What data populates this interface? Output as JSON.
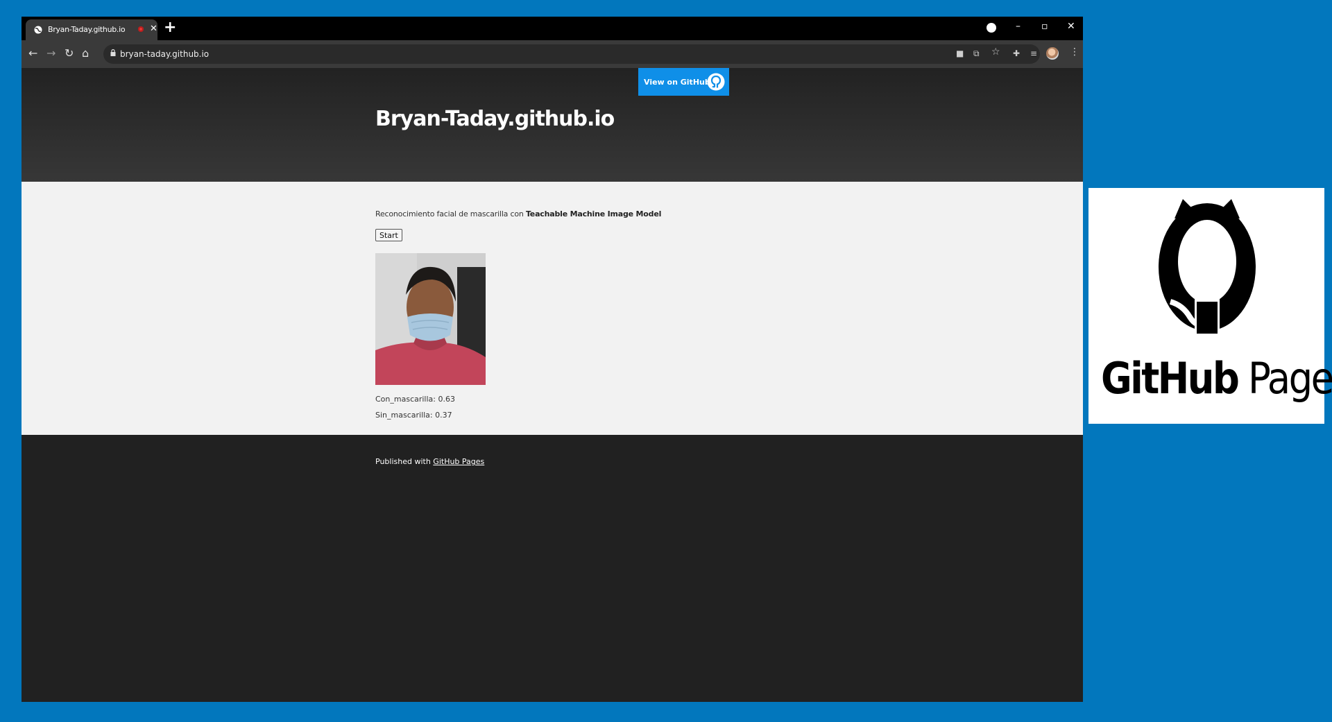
{
  "browser": {
    "tab_title": "Bryan-Taday.github.io",
    "url": "bryan-taday.github.io"
  },
  "header": {
    "github_button_label": "View on GitHub",
    "title": "Bryan-Taday.github.io"
  },
  "main": {
    "description_prefix": "Reconocimiento facial de mascarilla con ",
    "description_bold": "Teachable Machine Image Model",
    "start_label": "Start",
    "predictions": [
      {
        "text": "Con_mascarilla: 0.63"
      },
      {
        "text": "Sin_mascarilla: 0.37"
      }
    ]
  },
  "footer": {
    "prefix": "Published with ",
    "link": "GitHub Pages"
  },
  "logo_panel": {
    "text_bold": "GitHub",
    "text_light": "Pages"
  }
}
